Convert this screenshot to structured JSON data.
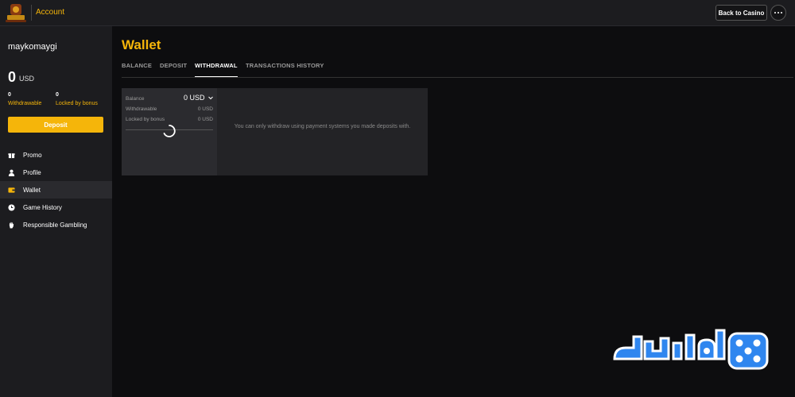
{
  "header": {
    "title": "Account",
    "back_label": "Back to Casino"
  },
  "account": {
    "username": "maykomaygi",
    "balance_amount": "0",
    "balance_currency": "USD",
    "withdrawable_value": "0",
    "withdrawable_label": "Withdrawable",
    "locked_value": "0",
    "locked_label": "Locked by bonus",
    "deposit_label": "Deposit"
  },
  "sidebar": {
    "items": [
      {
        "label": "Promo",
        "icon": "gift-icon",
        "active": false
      },
      {
        "label": "Profile",
        "icon": "user-icon",
        "active": false
      },
      {
        "label": "Wallet",
        "icon": "wallet-icon",
        "active": true
      },
      {
        "label": "Game History",
        "icon": "clock-icon",
        "active": false
      },
      {
        "label": "Responsible Gambling",
        "icon": "hand-icon",
        "active": false
      }
    ]
  },
  "main": {
    "title": "Wallet",
    "tabs": [
      {
        "label": "BALANCE",
        "active": false
      },
      {
        "label": "DEPOSIT",
        "active": false
      },
      {
        "label": "WITHDRAWAL",
        "active": true
      },
      {
        "label": "TRANSACTIONS HISTORY",
        "active": false
      }
    ],
    "panel": {
      "balance_label": "Balance",
      "balance_value": "0 USD",
      "withdrawable_label": "Withdrawable",
      "withdrawable_value": "0 USD",
      "locked_label": "Locked by bonus",
      "locked_value": "0 USD",
      "message": "You can only withdraw using payment systems you made deposits with."
    }
  },
  "colors": {
    "accent": "#f5b50a",
    "background": "#0d0d0f",
    "sidebar": "#1c1c1f",
    "watermark": "#2f86ef"
  }
}
